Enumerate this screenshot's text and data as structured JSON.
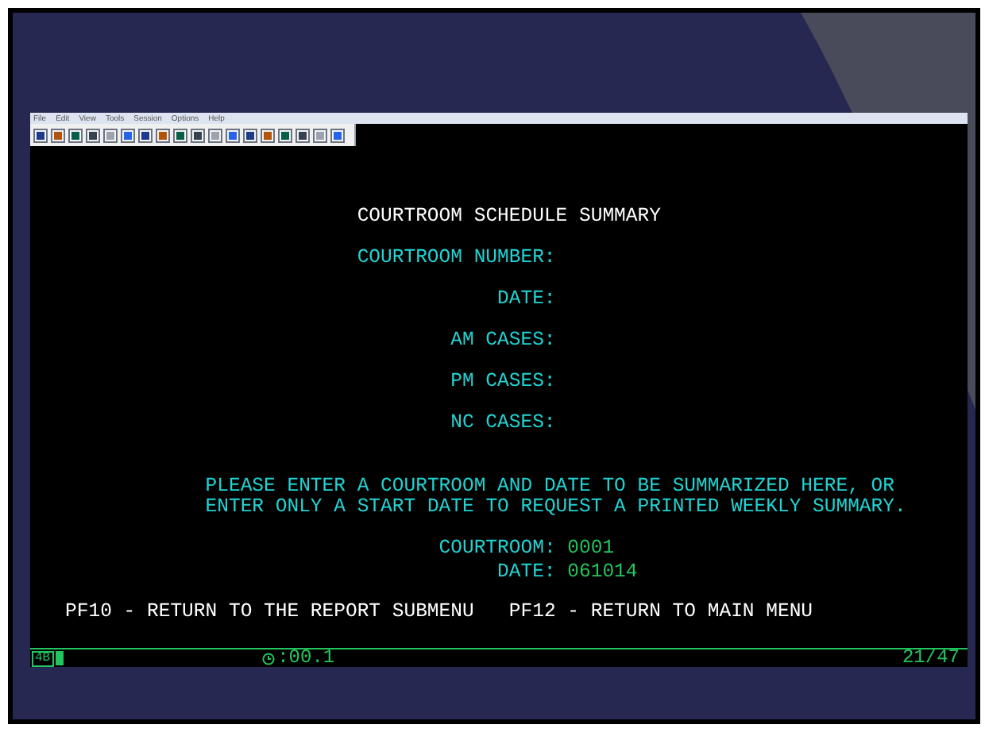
{
  "menu": [
    {
      "label": "File"
    },
    {
      "label": "Edit"
    },
    {
      "label": "View"
    },
    {
      "label": "Tools"
    },
    {
      "label": "Session"
    },
    {
      "label": "Options"
    },
    {
      "label": "Help"
    }
  ],
  "screen": {
    "title": "COURTROOM SCHEDULE SUMMARY",
    "fields": [
      {
        "label": "COURTROOM NUMBER:"
      },
      {
        "label": "DATE:"
      },
      {
        "label": "AM CASES:"
      },
      {
        "label": "PM CASES:"
      },
      {
        "label": "NC CASES:"
      }
    ],
    "message": [
      "PLEASE ENTER A COURTROOM AND DATE TO BE SUMMARIZED HERE, OR",
      "ENTER ONLY A START DATE TO REQUEST A PRINTED WEEKLY SUMMARY."
    ],
    "inputs": [
      {
        "label": "COURTROOM:",
        "value": "0001"
      },
      {
        "label": "DATE:",
        "value": "061014"
      }
    ],
    "function_keys": "PF10 - RETURN TO THE REPORT SUBMENU   PF12 - RETURN TO MAIN MENU"
  },
  "status_bar": {
    "session": "4B",
    "timer": ":00.1",
    "cursor": "21/47"
  }
}
